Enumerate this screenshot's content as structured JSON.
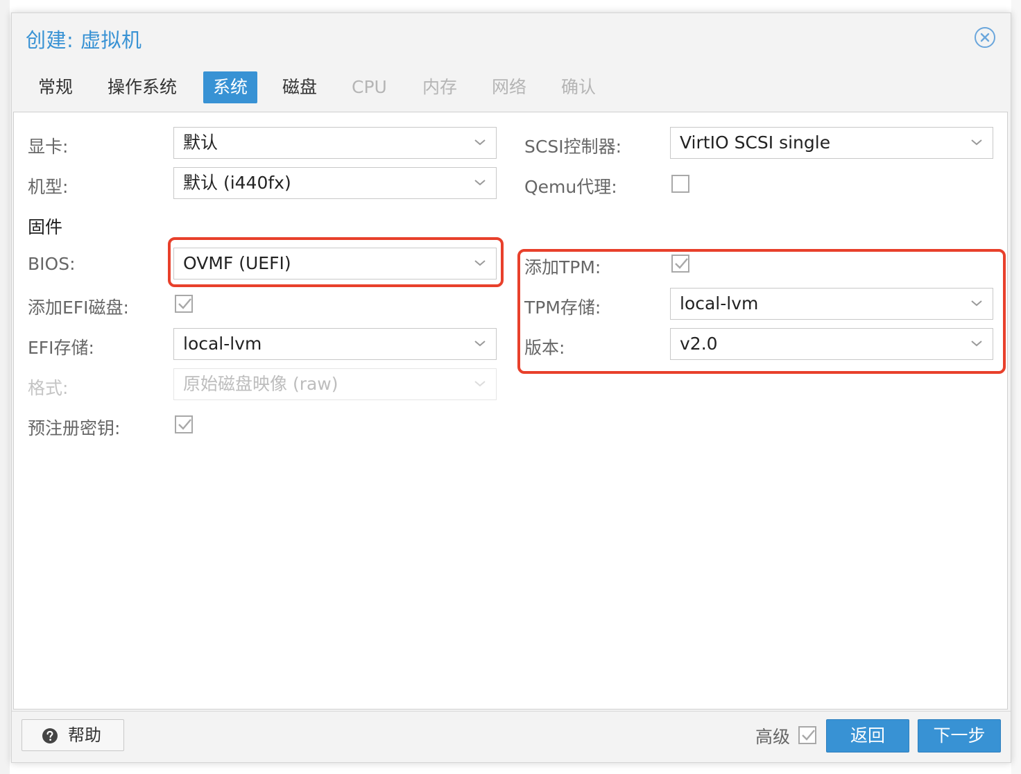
{
  "dialog": {
    "title": "创建: 虚拟机"
  },
  "tabs": [
    {
      "label": "常规",
      "state": "normal"
    },
    {
      "label": "操作系统",
      "state": "normal"
    },
    {
      "label": "系统",
      "state": "active"
    },
    {
      "label": "磁盘",
      "state": "normal"
    },
    {
      "label": "CPU",
      "state": "disabled"
    },
    {
      "label": "内存",
      "state": "disabled"
    },
    {
      "label": "网络",
      "state": "disabled"
    },
    {
      "label": "确认",
      "state": "disabled"
    }
  ],
  "left": {
    "graphics_label": "显卡:",
    "graphics_value": "默认",
    "machine_label": "机型:",
    "machine_value": "默认 (i440fx)",
    "firmware_section": "固件",
    "bios_label": "BIOS:",
    "bios_value": "OVMF (UEFI)",
    "add_efi_label": "添加EFI磁盘:",
    "add_efi_checked": true,
    "efi_storage_label": "EFI存储:",
    "efi_storage_value": "local-lvm",
    "format_label": "格式:",
    "format_value": "原始磁盘映像 (raw)",
    "pre_enroll_label": "预注册密钥:",
    "pre_enroll_checked": true
  },
  "right": {
    "scsi_label": "SCSI控制器:",
    "scsi_value": "VirtIO SCSI single",
    "qemu_agent_label": "Qemu代理:",
    "qemu_agent_checked": false,
    "add_tpm_label": "添加TPM:",
    "add_tpm_checked": true,
    "tpm_storage_label": "TPM存储:",
    "tpm_storage_value": "local-lvm",
    "version_label": "版本:",
    "version_value": "v2.0"
  },
  "footer": {
    "help_label": "帮助",
    "advanced_label": "高级",
    "advanced_checked": true,
    "back_label": "返回",
    "next_label": "下一步"
  },
  "colors": {
    "accent": "#3892d4",
    "highlight": "#e8402b"
  }
}
